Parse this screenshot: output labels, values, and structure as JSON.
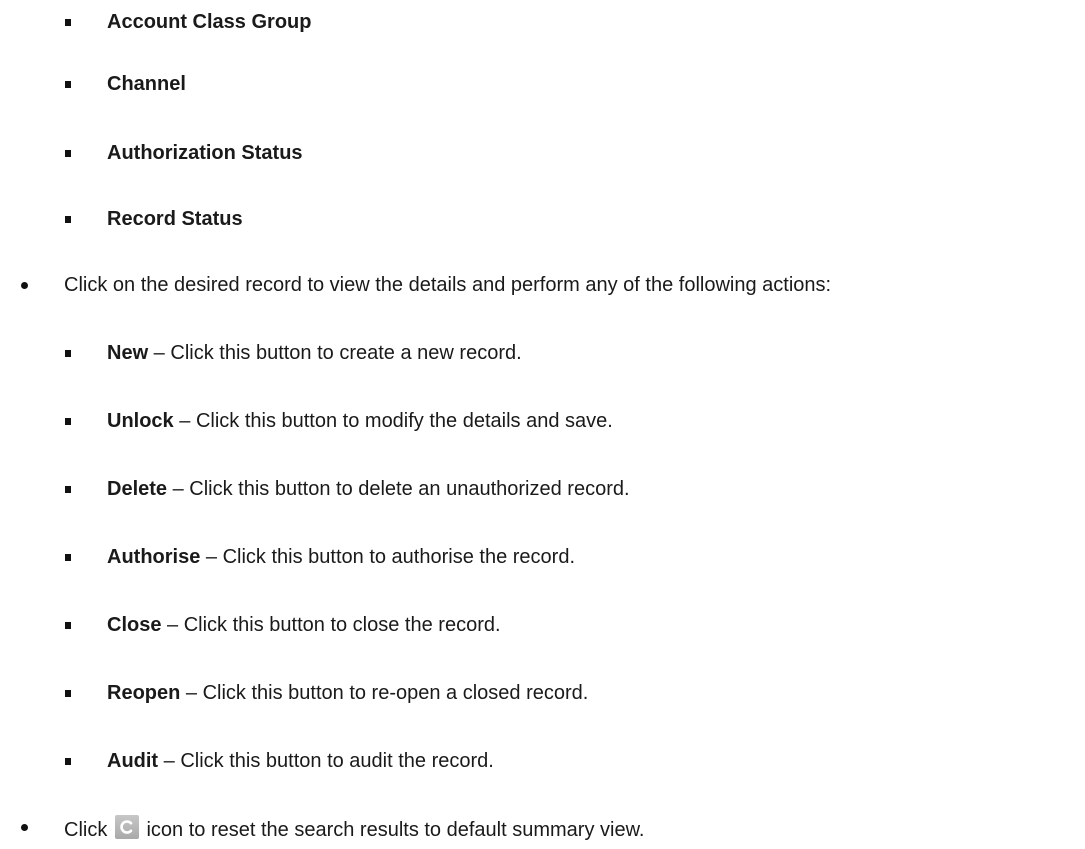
{
  "filters": [
    "Account Class Group",
    "Channel",
    "Authorization Status",
    "Record Status"
  ],
  "record_instruction": "Click on the desired record to view the details and perform any of the following actions:",
  "actions": [
    {
      "name": "New",
      "separator": " – ",
      "desc": "Click this button to create a new record."
    },
    {
      "name": "Unlock",
      "separator": " – ",
      "desc": "Click this button to modify the details and save."
    },
    {
      "name": "Delete",
      "separator": " – ",
      "desc": "Click this button to delete an unauthorized record."
    },
    {
      "name": "Authorise",
      "separator": " – ",
      "desc": "Click this button to authorise the record."
    },
    {
      "name": "Close",
      "separator": " – ",
      "desc": "Click this button to close the record."
    },
    {
      "name": "Reopen",
      "separator": " – ",
      "desc": "Click this button to re-open a closed record."
    },
    {
      "name": "Audit",
      "separator": " – ",
      "desc": "Click this button to audit the record."
    }
  ],
  "reset": {
    "before": "Click",
    "icon": "reset-icon",
    "after": "icon to reset the search results to default summary view."
  }
}
